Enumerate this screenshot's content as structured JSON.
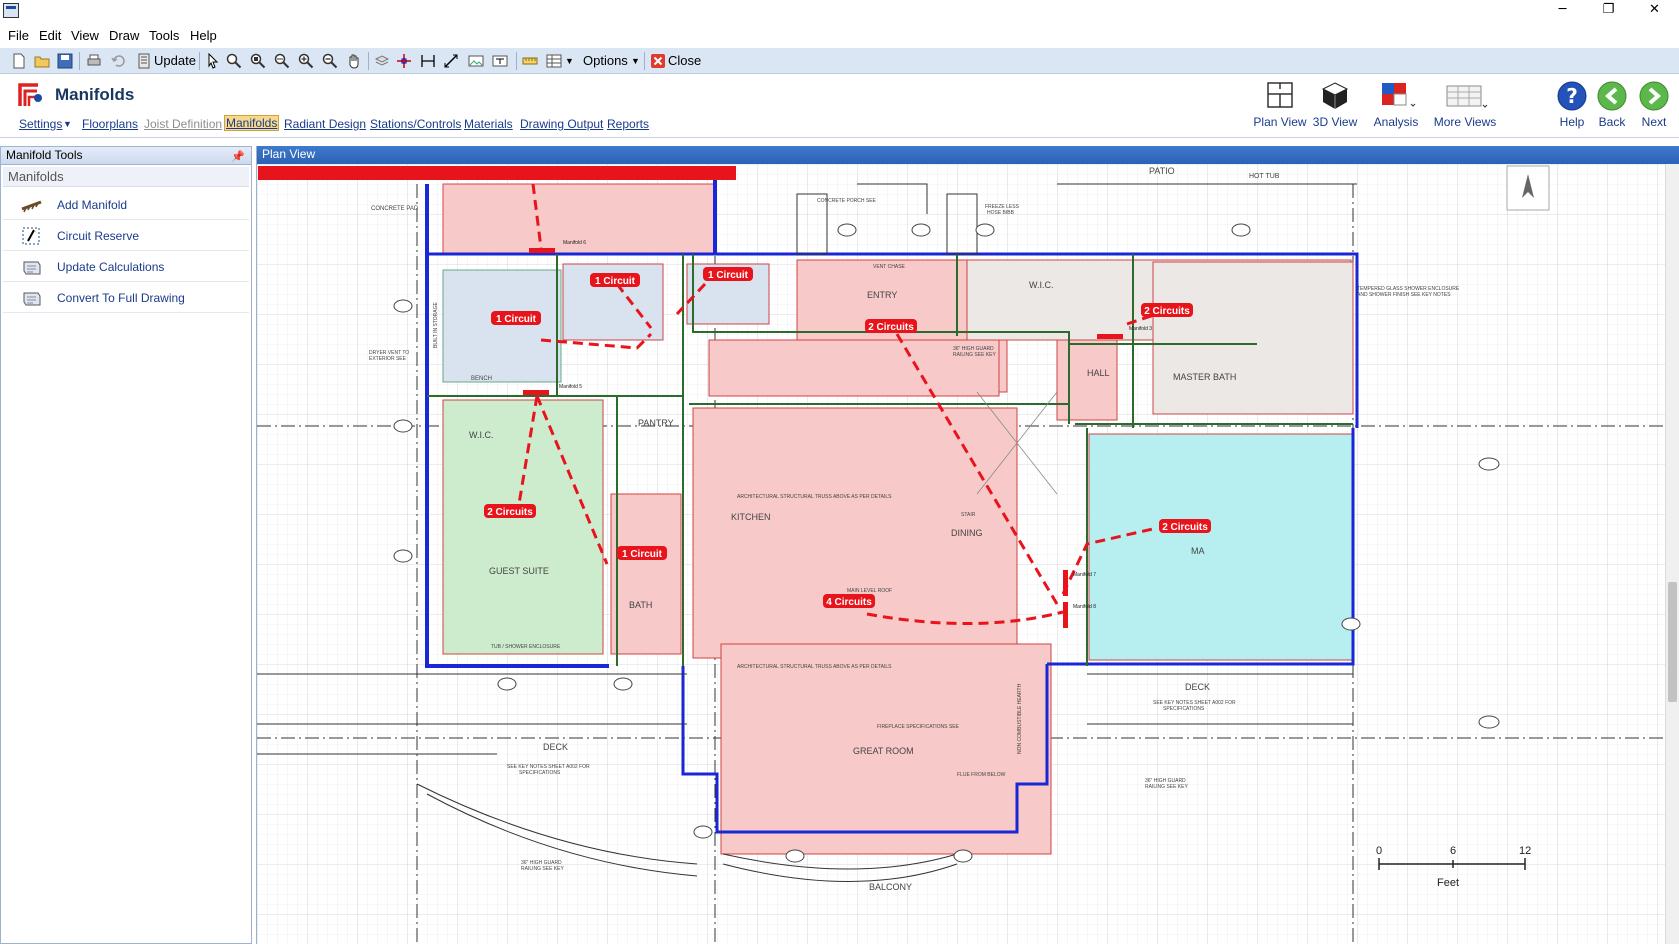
{
  "window": {
    "controls": {
      "minimize": "─",
      "restore": "❐",
      "close": "✕"
    }
  },
  "menu": [
    "File",
    "Edit",
    "View",
    "Draw",
    "Tools",
    "Help"
  ],
  "toolbar": {
    "update_label": "Update",
    "options_label": "Options",
    "close_label": "Close"
  },
  "ribbon": {
    "module_title": "Manifolds",
    "nav": [
      {
        "label": "Settings"
      },
      {
        "label": "Floorplans"
      },
      {
        "label": "Joist Definition"
      },
      {
        "label": "Manifolds"
      },
      {
        "label": "Radiant Design"
      },
      {
        "label": "Stations/Controls"
      },
      {
        "label": "Materials"
      },
      {
        "label": "Drawing Output"
      },
      {
        "label": "Reports"
      }
    ],
    "buttons": [
      {
        "label": "Plan View"
      },
      {
        "label": "3D View"
      },
      {
        "label": "Analysis"
      },
      {
        "label": "More Views"
      },
      {
        "label": "Help"
      },
      {
        "label": "Back"
      },
      {
        "label": "Next"
      }
    ]
  },
  "panel": {
    "title": "Manifold Tools",
    "group": "Manifolds",
    "items": [
      {
        "label": "Add Manifold",
        "icon": "add-manifold-icon"
      },
      {
        "label": "Circuit Reserve",
        "icon": "circuit-reserve-icon"
      },
      {
        "label": "Update Calculations",
        "icon": "update-calculations-icon"
      },
      {
        "label": "Convert To Full Drawing",
        "icon": "convert-drawing-icon"
      }
    ]
  },
  "view": {
    "title": "Plan View",
    "badges": {
      "b1": "1 Circuit",
      "b2": "1 Circuit",
      "b3": "1 Circuit",
      "b4": "2 Circuits",
      "b5": "2 Circuits",
      "b6": "2 Circuits",
      "b7": "1 Circuit",
      "b8": "4 Circuits",
      "b9": "2 Circuits"
    },
    "rooms": {
      "patio": "PATIO",
      "hot_tub": "HOT TUB",
      "concrete_pad": "CONCRETE PAD",
      "entry": "ENTRY",
      "wic1": "W.I.C.",
      "wic2": "W.I.C.",
      "master_bath": "MASTER BATH",
      "hall": "HALL",
      "pantry": "PANTRY",
      "kitchen": "KITCHEN",
      "dining": "DINING",
      "guest_suite": "GUEST SUITE",
      "bath": "BATH",
      "great_room": "GREAT ROOM",
      "deck1": "DECK",
      "deck2": "DECK",
      "balcony": "BALCONY",
      "bench": "BENCH",
      "master": "MA"
    },
    "manifolds": {
      "m6": "Manifold 6",
      "m5": "Manifold 5",
      "m3": "Manifold 3",
      "m7": "Manifold 7",
      "m8": "Manifold 8"
    },
    "notes": {
      "n1": "TEMPERED GLASS SHOWER ENCLOSURE",
      "n2": "AND SHOWER FINISH SEE KEY NOTES",
      "n3": "DRYER VENT TO",
      "n4": "EXTERIOR SEE",
      "n5": "ARCHITECTURAL STRUCTURAL TRUSS ABOVE AS PER DETAILS",
      "n6": "36\" HIGH GUARD",
      "n7": "RAILING SEE KEY",
      "n8": "FIREPLACE SPECIFICATIONS SEE",
      "n9": "FLUE FROM BELOW",
      "n10": "SEE KEY NOTES SHEET A002 FOR",
      "n11": "SPECIFICATIONS",
      "n12": "CONCRETE PORCH SEE",
      "n13": "FREEZE LESS",
      "n14": "HOSE BIBB",
      "n15": "TUB / SHOWER ENCLOSURE",
      "n16": "MAIN LEVEL ROOF",
      "n17": "STAIR",
      "n18": "VENT CHASE",
      "n19": "BUILT IN STORAGE",
      "n20": "NON COMBUSTIBLE HEARTH"
    },
    "scale": {
      "t0": "0",
      "t1": "6",
      "t2": "12",
      "unit": "Feet"
    }
  }
}
